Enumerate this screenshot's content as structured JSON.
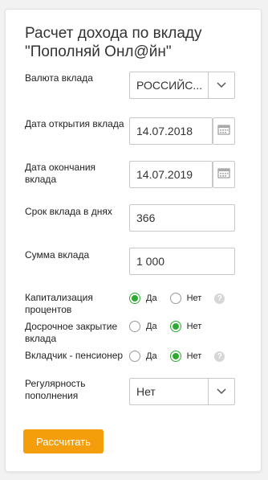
{
  "title": "Расчет дохода по вкладу \"Пополняй Онл@йн\"",
  "currency": {
    "label": "Валюта вклада",
    "value": "РОССИЙС..."
  },
  "open_date": {
    "label": "Дата открытия вклада",
    "value": "14.07.2018"
  },
  "close_date": {
    "label": "Дата окончания вклада",
    "value": "14.07.2019"
  },
  "term_days": {
    "label": "Срок вклада в днях",
    "value": "366"
  },
  "amount": {
    "label": "Сумма вклада",
    "value": "1 000"
  },
  "capitalization": {
    "label": "Капитализация процентов",
    "yes": "Да",
    "no": "Нет",
    "selected": "yes"
  },
  "early_close": {
    "label": "Досрочное закрытие вклада",
    "yes": "Да",
    "no": "Нет",
    "selected": "no"
  },
  "pensioner": {
    "label": "Вкладчик - пенсионер",
    "yes": "Да",
    "no": "Нет",
    "selected": "no"
  },
  "regularity": {
    "label": "Регулярность пополнения",
    "value": "Нет"
  },
  "help_glyph": "?",
  "calculate_button": "Рассчитать",
  "colors": {
    "accent_button": "#f59e0c",
    "radio_on": "#2eaa33"
  }
}
